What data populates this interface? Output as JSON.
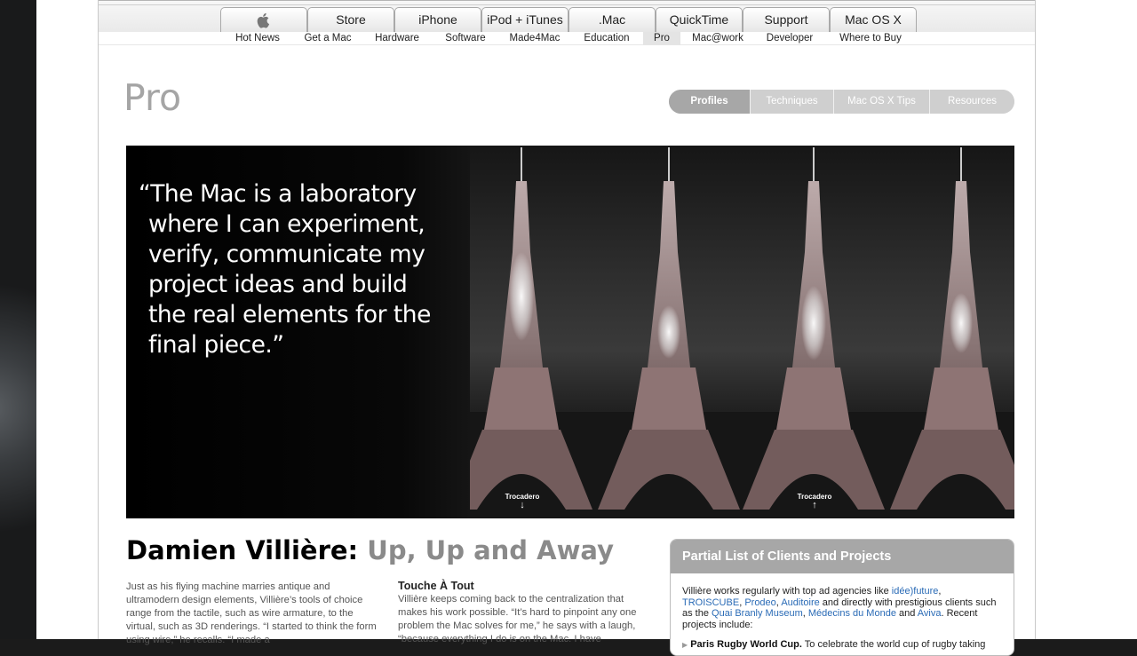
{
  "global_nav": {
    "apple_logo": "apple-logo-icon",
    "tabs": [
      "Store",
      "iPhone",
      "iPod + iTunes",
      ".Mac",
      "QuickTime",
      "Support",
      "Mac OS X"
    ]
  },
  "sub_nav": {
    "items": [
      "Hot News",
      "Get a Mac",
      "Hardware",
      "Software",
      "Made4Mac",
      "Education",
      "Pro",
      "Mac@work",
      "Developer",
      "Where to Buy"
    ],
    "active": "Pro"
  },
  "section_title": "Pro",
  "local_nav": {
    "tabs": [
      "Profiles",
      "Techniques",
      "Mac OS X Tips",
      "Resources"
    ],
    "active": "Profiles"
  },
  "hero": {
    "quote_lines": [
      "“The Mac is a laboratory",
      "where I can experiment,",
      "verify, communicate my",
      "project ideas and build",
      "the real elements for the",
      "final piece.”"
    ],
    "markers": [
      {
        "label": "Trocadero",
        "arrow": "↓"
      },
      {
        "label": "Trocadero",
        "arrow": "↑"
      }
    ]
  },
  "article": {
    "headline_name": "Damien Villière:",
    "headline_sub": "Up, Up and Away",
    "col1": "Just as his flying machine marries antique and ultramodern design elements, Villière’s tools of choice range from the tactile, such as wire armature, to the virtual, such as 3D renderings. “I started to think the form using wire,” he recalls. “I made a",
    "col2_heading": "Touche À Tout",
    "col2": "Villière keeps coming back to the centralization that makes his work possible. “It’s hard to pinpoint any one problem the Mac solves for me,” he says with a laugh, “because everything I do is on the Mac. I have"
  },
  "clients": {
    "title": "Partial List of Clients and Projects",
    "intro_1": "Villière works regularly with top ad agencies like ",
    "link_1": "idée)future",
    "sep_1": ", ",
    "link_2": "TROISCUBE",
    "sep_2": ",",
    "link_3": "Prodeo",
    "sep_3": ", ",
    "link_4": "Auditoire",
    "intro_2": " and directly with prestigious clients such as the ",
    "link_5": "Quai Branly Museum",
    "sep_4": ", ",
    "link_6": "Médecins du Monde",
    "sep_5": " and ",
    "link_7": "Aviva",
    "intro_3": ". Recent projects include:",
    "bullet_title": "Paris Rugby World Cup.",
    "bullet_text": " To celebrate the world cup of rugby taking"
  },
  "colors": {
    "link": "#2a6bb6",
    "section_gray": "#a5a5a5",
    "box_header": "#a7a7a7"
  }
}
